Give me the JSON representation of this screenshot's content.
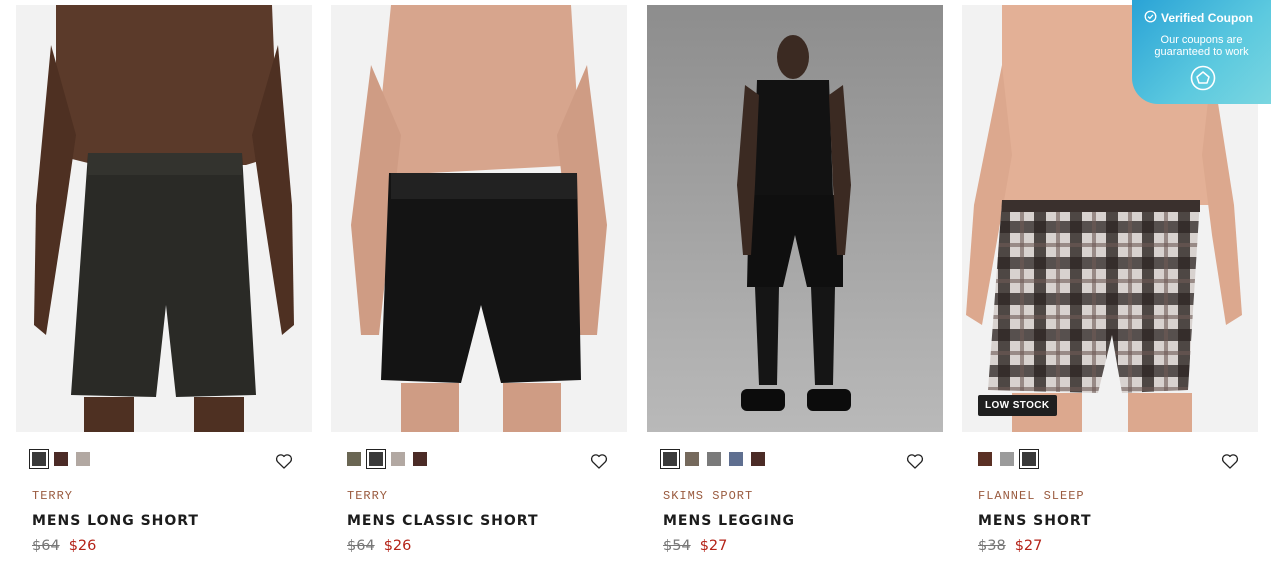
{
  "products": [
    {
      "category": "TERRY",
      "name": "MENS LONG SHORT",
      "old_price": "$64",
      "sale_price": "$26",
      "swatches": [
        {
          "color": "#3a3a3a",
          "selected": true
        },
        {
          "color": "#4b2b26",
          "selected": false
        },
        {
          "color": "#b2a8a2",
          "selected": false
        }
      ]
    },
    {
      "category": "TERRY",
      "name": "MENS CLASSIC SHORT",
      "old_price": "$64",
      "sale_price": "$26",
      "swatches": [
        {
          "color": "#6a6653",
          "selected": false
        },
        {
          "color": "#3a3a3a",
          "selected": true
        },
        {
          "color": "#b2a8a2",
          "selected": false
        },
        {
          "color": "#4b2b26",
          "selected": false
        }
      ]
    },
    {
      "category": "SKIMS SPORT",
      "name": "MENS LEGGING",
      "old_price": "$54",
      "sale_price": "$27",
      "swatches": [
        {
          "color": "#3a3a3a",
          "selected": true
        },
        {
          "color": "#75695c",
          "selected": false
        },
        {
          "color": "#7a7a7a",
          "selected": false
        },
        {
          "color": "#5f6f90",
          "selected": false
        },
        {
          "color": "#4b2b26",
          "selected": false
        }
      ]
    },
    {
      "category": "FLANNEL SLEEP",
      "name": "MENS SHORT",
      "old_price": "$38",
      "sale_price": "$27",
      "badge": "LOW STOCK",
      "swatches": [
        {
          "color": "#5a3024",
          "selected": false
        },
        {
          "color": "#9b9b9b",
          "selected": false
        },
        {
          "color": "#3a3a3a",
          "selected": true
        }
      ]
    }
  ],
  "coupon": {
    "title": "Verified Coupon",
    "subtitle_line1": "Our coupons are",
    "subtitle_line2": "guaranteed to work",
    "logo_icon": "coupon-brand-icon"
  },
  "icons": {
    "wishlist": "heart-icon",
    "verified": "check-circle-icon"
  },
  "colors": {
    "category_text": "#9a5b3f",
    "sale_price": "#b42318",
    "coupon_gradient_start": "#2aa3d6",
    "coupon_gradient_end": "#7ad6e0"
  }
}
